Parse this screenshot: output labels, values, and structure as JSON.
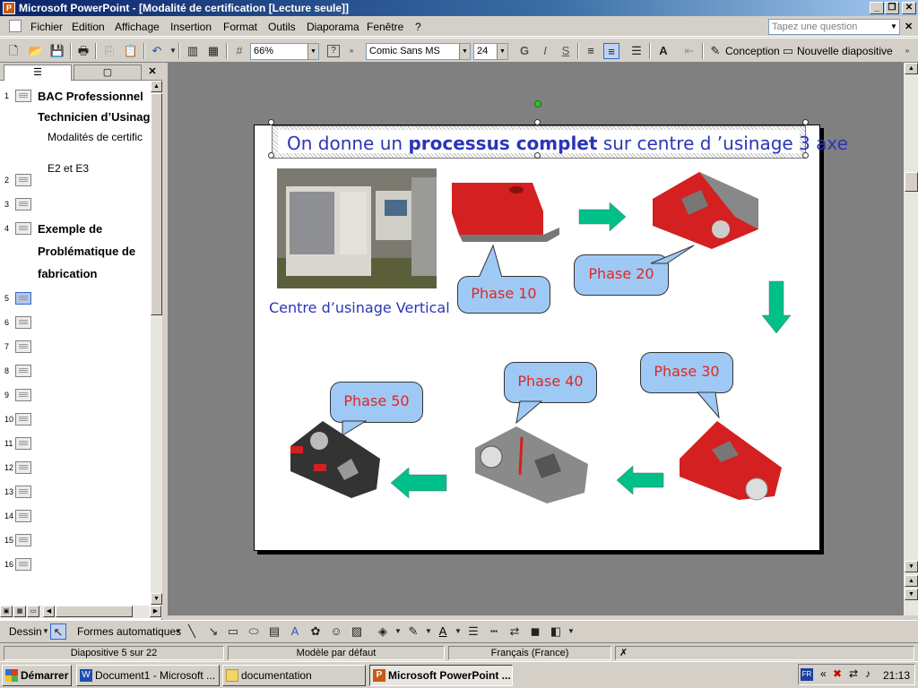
{
  "window": {
    "title": "Microsoft PowerPoint - [Modalité de certification [Lecture seule]]",
    "min_label": "_",
    "restore_label": "❐",
    "close_label": "✕"
  },
  "menu": {
    "items": [
      "Fichier",
      "Edition",
      "Affichage",
      "Insertion",
      "Format",
      "Outils",
      "Diaporama",
      "Fenêtre",
      "?"
    ],
    "ask_placeholder": "Tapez une question"
  },
  "toolbar": {
    "zoom": "66%",
    "font": "Comic Sans MS",
    "size": "24",
    "bold": "G",
    "italic": "I",
    "shadow": "S",
    "design_label": "Conception",
    "new_slide_label": "Nouvelle diapositive"
  },
  "outline": {
    "slides": [
      {
        "num": "1",
        "lines": [
          {
            "text": "BAC Professionnel",
            "style": "b"
          },
          {
            "text": "Technicien d’Usinag",
            "style": "b"
          },
          {
            "text": "Modalités de certific",
            "style": "sub"
          },
          {
            "text": "E2 et E3",
            "style": "sub"
          }
        ]
      },
      {
        "num": "2",
        "lines": []
      },
      {
        "num": "3",
        "lines": []
      },
      {
        "num": "4",
        "lines": [
          {
            "text": "Exemple de",
            "style": "b"
          },
          {
            "text": "Problématique de",
            "style": "b"
          },
          {
            "text": "fabrication",
            "style": "b"
          }
        ]
      },
      {
        "num": "5",
        "lines": []
      },
      {
        "num": "6",
        "lines": []
      },
      {
        "num": "7",
        "lines": []
      },
      {
        "num": "8",
        "lines": []
      },
      {
        "num": "9",
        "lines": []
      },
      {
        "num": "10",
        "lines": []
      },
      {
        "num": "11",
        "lines": []
      },
      {
        "num": "12",
        "lines": []
      },
      {
        "num": "13",
        "lines": []
      },
      {
        "num": "14",
        "lines": []
      },
      {
        "num": "15",
        "lines": []
      },
      {
        "num": "16",
        "lines": []
      }
    ]
  },
  "slide": {
    "title_pre": "On donne un ",
    "title_bold": "processus complet",
    "title_post": " sur centre d ’usinage 3 axe",
    "caption": "Centre d’usinage Vertical",
    "phases": {
      "p10": "Phase 10",
      "p20": "Phase 20",
      "p30": "Phase 30",
      "p40": "Phase 40",
      "p50": "Phase 50"
    },
    "colors": {
      "title": "#2b35b8",
      "callout_bg": "#9fc9f5",
      "callout_text": "#e0281f",
      "arrow": "#00c08a",
      "part": "#d42020"
    }
  },
  "drawbar": {
    "draw_label": "Dessin",
    "autoshapes_label": "Formes automatiques"
  },
  "status": {
    "slide_info": "Diapositive 5 sur 22",
    "template": "Modèle par défaut",
    "language": "Français (France)"
  },
  "taskbar": {
    "start_label": "Démarrer",
    "tasks": [
      "Document1 - Microsoft ...",
      "documentation",
      "Microsoft PowerPoint ..."
    ],
    "clock": "21:13",
    "lang": "FR"
  }
}
